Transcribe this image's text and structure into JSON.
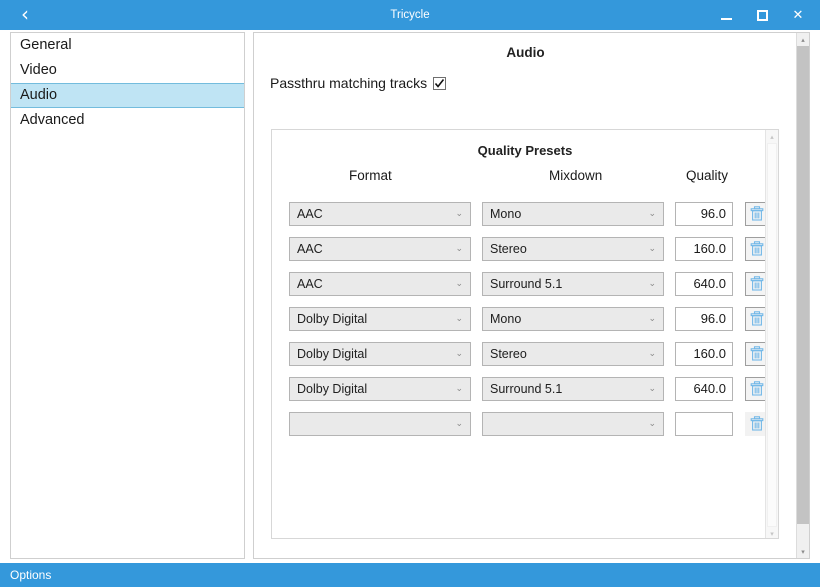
{
  "titlebar": {
    "back_icon": "chevron-left-icon",
    "title": "Tricycle",
    "minimize_label": "–",
    "maximize_label": "□",
    "close_label": "✕"
  },
  "sidebar": {
    "items": [
      {
        "label": "General",
        "selected": false
      },
      {
        "label": "Video",
        "selected": false
      },
      {
        "label": "Audio",
        "selected": true
      },
      {
        "label": "Advanced",
        "selected": false
      }
    ]
  },
  "panel": {
    "title": "Audio",
    "passthru": {
      "label": "Passthru matching tracks",
      "checked": true
    },
    "group": {
      "title": "Quality Presets",
      "columns": {
        "format": "Format",
        "mixdown": "Mixdown",
        "quality": "Quality"
      },
      "rows": [
        {
          "format": "AAC",
          "mixdown": "Mono",
          "quality": "96.0",
          "delete_icon": "trash-icon",
          "empty": false
        },
        {
          "format": "AAC",
          "mixdown": "Stereo",
          "quality": "160.0",
          "delete_icon": "trash-icon",
          "empty": false
        },
        {
          "format": "AAC",
          "mixdown": "Surround 5.1",
          "quality": "640.0",
          "delete_icon": "trash-icon",
          "empty": false
        },
        {
          "format": "Dolby Digital",
          "mixdown": "Mono",
          "quality": "96.0",
          "delete_icon": "trash-icon",
          "empty": false
        },
        {
          "format": "Dolby Digital",
          "mixdown": "Stereo",
          "quality": "160.0",
          "delete_icon": "trash-icon",
          "empty": false
        },
        {
          "format": "Dolby Digital",
          "mixdown": "Surround 5.1",
          "quality": "640.0",
          "delete_icon": "trash-icon",
          "empty": false
        },
        {
          "format": "",
          "mixdown": "",
          "quality": "",
          "delete_icon": "trash-icon",
          "empty": true
        }
      ],
      "dropdown_caret": "⌄"
    }
  },
  "scrollbars": {
    "up_arrow": "▴",
    "down_arrow": "▾"
  },
  "statusbar": {
    "text": "Options"
  },
  "colors": {
    "accent": "#3498db",
    "selection": "#bfe4f4",
    "trash": "#73b8e8"
  }
}
